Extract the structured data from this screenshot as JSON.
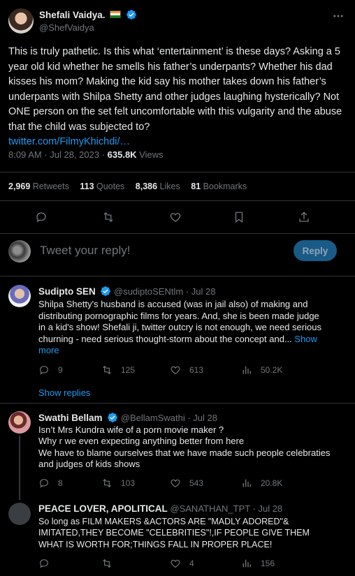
{
  "main_tweet": {
    "display_name": "Shefali Vaidya.",
    "flag_country": "India",
    "handle": "@ShefVaidya",
    "text": "This is truly pathetic. Is this what ‘entertainment’ is these days? Asking a 5 year old kid whether he smells his father’s underpants? Whether his dad kisses his mom? Making the kid say his mother takes down his father’s underpants with Shilpa Shetty and other judges laughing hysterically? Not ONE person on the set felt uncomfortable with this vulgarity and the abuse that the child was subjected to?",
    "link": "twitter.com/FilmyKhichdi/…",
    "time": "8:09 AM · Jul 28, 2023 · ",
    "views_count": "635.8K",
    "views_label": " Views",
    "stats": {
      "retweets_count": "2,969",
      "retweets_label": " Retweets",
      "quotes_count": "113",
      "quotes_label": " Quotes",
      "likes_count": "8,386",
      "likes_label": " Likes",
      "bookmarks_count": "81",
      "bookmarks_label": " Bookmarks"
    }
  },
  "composer": {
    "placeholder": "Tweet your reply!",
    "reply_button": "Reply"
  },
  "replies": [
    {
      "name": "Sudipto SEN",
      "handle": "@sudiptoSENtlm",
      "dot": " · ",
      "date": "Jul 28",
      "text": "Shilpa Shetty's husband is accused (was in jail also) of making and distributing pornographic films for years. And, she is been made judge in a kid's show! Shefali ji, twitter outcry is not enough, we need serious churning - need serious thought-storm about the concept and...",
      "show_more": " Show more",
      "replies": "9",
      "retweets": "125",
      "likes": "613",
      "views": "50.2K",
      "show_replies": "Show replies"
    },
    {
      "name": "Swathi Bellam",
      "handle": "@BellamSwathi",
      "dot": " · ",
      "date": "Jul 28",
      "lines": [
        "Isn’t Mrs Kundra wife of a porn movie maker ?",
        "Why r we even expecting anything better from here",
        "We have to blame ourselves that we have made such people celebraties and judges of kids shows"
      ],
      "replies": "8",
      "retweets": "103",
      "likes": "543",
      "views": "20.8K"
    },
    {
      "name": "PEACE LOVER, APOLITICAL",
      "handle": "@SANATHAN_TPT",
      "dot": " · ",
      "date": "Jul 28",
      "text": "So long as FILM MAKERS &ACTORS ARE \"MADLY ADORED\"& IMITATED,THEY BECOME \"CELEBRITIES\"!,IF PEOPLE GIVE THEM WHAT IS WORTH FOR;THINGS FALL IN PROPER PLACE!",
      "replies": "",
      "retweets": "",
      "likes": "4",
      "views": "156"
    }
  ],
  "colors": {
    "accent": "#1d9bf0",
    "reply_button_bg": "#1a5a86",
    "verified": "#1d9bf0"
  },
  "icons": [
    "more-icon",
    "verified-icon",
    "india-flag-icon",
    "reply-icon",
    "retweet-icon",
    "like-icon",
    "bookmark-icon",
    "share-icon",
    "views-icon"
  ]
}
